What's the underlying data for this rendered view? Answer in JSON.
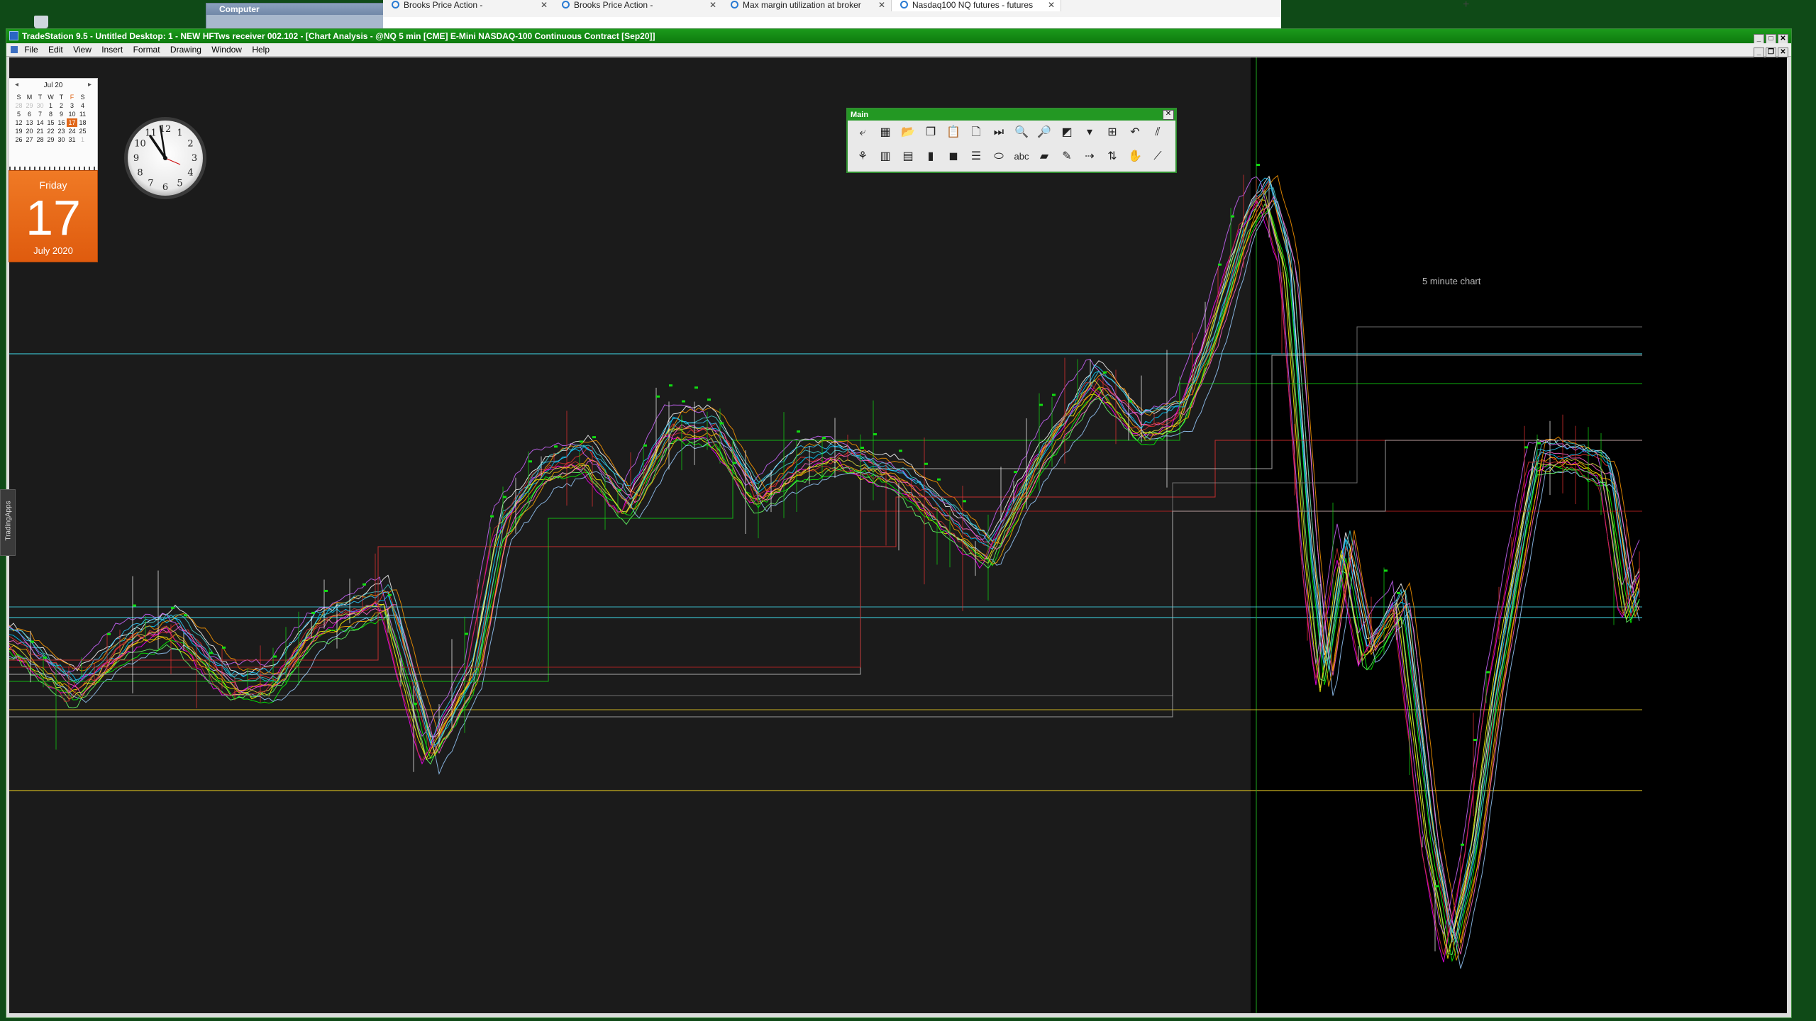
{
  "browser": {
    "tabs": [
      {
        "label": "Brooks Price Action -",
        "active": false
      },
      {
        "label": "Brooks Price Action -",
        "active": false
      },
      {
        "label": "Max margin utilization at broker",
        "active": false
      },
      {
        "label": "Nasdaq100 NQ futures - futures",
        "active": true
      }
    ],
    "new_tab": "+"
  },
  "computer_window": {
    "title": "Computer"
  },
  "tradestation": {
    "title": "TradeStation 9.5 - Untitled Desktop: 1 - NEW HFTws receiver 002.102 - [Chart Analysis - @NQ 5 min [CME] E-Mini NASDAQ-100 Continuous Contract [Sep20]]",
    "menu": [
      "File",
      "Edit",
      "View",
      "Insert",
      "Format",
      "Drawing",
      "Window",
      "Help"
    ],
    "chart_label": "5 minute chart",
    "side_tab": "TradingApps"
  },
  "calendar": {
    "month": "Jul 20",
    "weekdays": [
      "S",
      "M",
      "T",
      "W",
      "T",
      "F",
      "S"
    ],
    "weeks": [
      [
        "28",
        "29",
        "30",
        "1",
        "2",
        "3",
        "4"
      ],
      [
        "5",
        "6",
        "7",
        "8",
        "9",
        "10",
        "11"
      ],
      [
        "12",
        "13",
        "14",
        "15",
        "16",
        "17",
        "18"
      ],
      [
        "19",
        "20",
        "21",
        "22",
        "23",
        "24",
        "25"
      ],
      [
        "26",
        "27",
        "28",
        "29",
        "30",
        "31",
        "1"
      ]
    ],
    "today": "17",
    "day_of_week": "Friday",
    "day": "17",
    "month_year": "July 2020"
  },
  "clock": {
    "numbers": [
      "12",
      "1",
      "2",
      "3",
      "4",
      "5",
      "6",
      "7",
      "8",
      "9",
      "10",
      "11"
    ]
  },
  "toolbar": {
    "title": "Main",
    "row1_icons": [
      "new-chart-icon",
      "grid-window-icon",
      "open-folder-icon",
      "copy-windows-icon",
      "paste-icon",
      "document-icon",
      "play-end-icon",
      "zoom-in-icon",
      "zoom-out-icon",
      "color-picker-icon",
      "dropdown-arrow-icon",
      "grid-select-icon",
      "curve-tool-icon",
      "pitchfork-icon"
    ],
    "row1_glyphs": [
      "⤶",
      "▦",
      "📂",
      "❐",
      "📋",
      "🗋",
      "⏭",
      "🔍",
      "🔎",
      "◩",
      "▾",
      "⊞",
      "↶",
      "⫽"
    ],
    "row2_icons": [
      "indicator-icon",
      "panel-icon",
      "layout-icon",
      "traffic-light-icon",
      "camera-icon",
      "horizontal-lines-icon",
      "ellipse-icon",
      "text-abc-icon",
      "eraser-icon",
      "pencil-icon",
      "arrow-line-icon",
      "up-down-arrow-icon",
      "hand-icon",
      "trendline-icon"
    ],
    "row2_glyphs": [
      "⚘",
      "▥",
      "▤",
      "▮",
      "◼",
      "☰",
      "⬭",
      "abc",
      "▰",
      "✎",
      "⇢",
      "⇅",
      "✋",
      "⟋"
    ]
  },
  "colors": {
    "desktop_bg": "#0f4a17",
    "ts_title": "#0d7a0d",
    "chart_bg": "#1b1b1b",
    "chart_dark_bg": "#000000",
    "accent_orange": "#e0671a"
  }
}
